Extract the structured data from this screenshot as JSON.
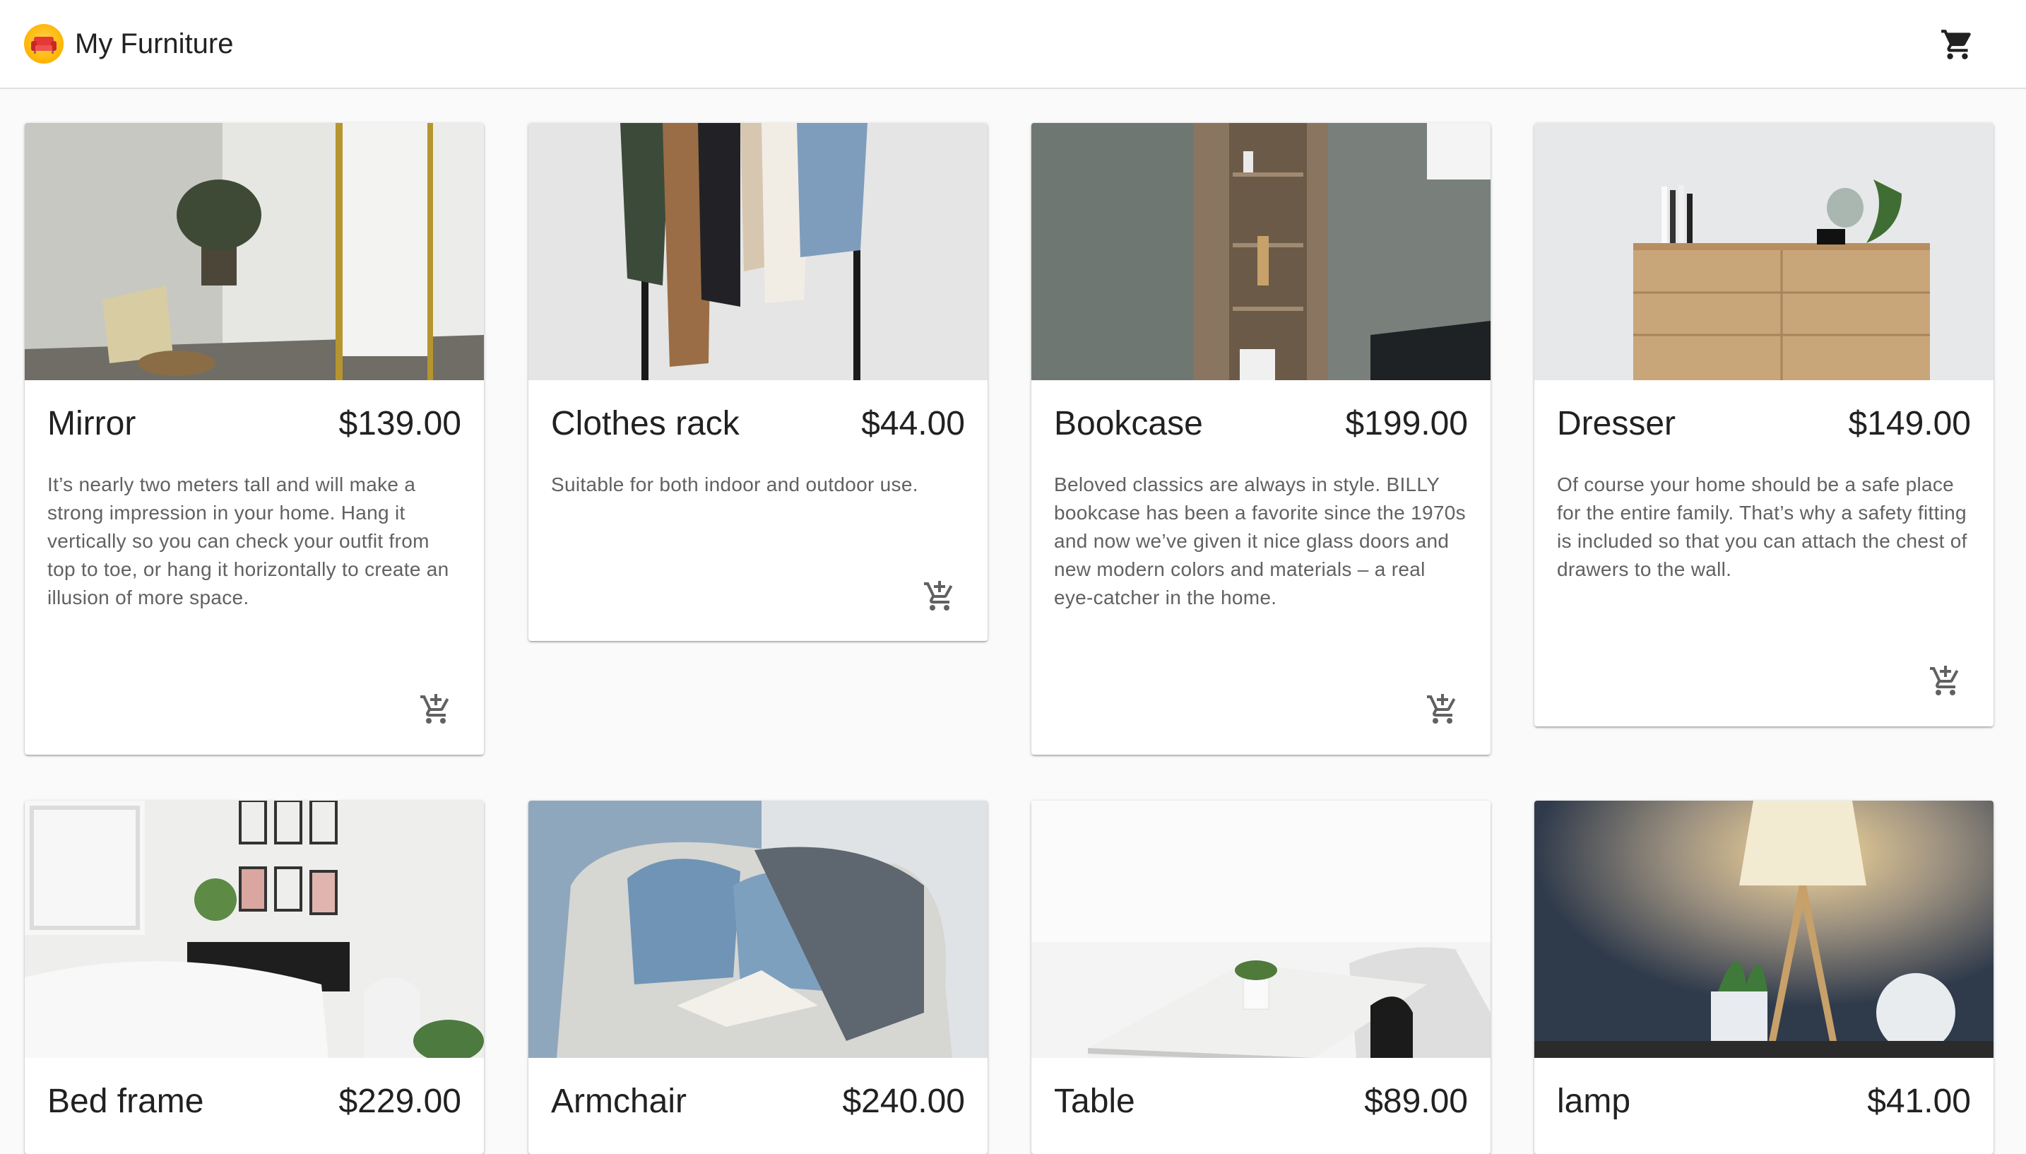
{
  "app": {
    "title": "My Furniture",
    "logo_icon": "sofa-icon",
    "cart_icon": "shopping-cart-icon"
  },
  "colors": {
    "appbar": "#ffffff",
    "background": "#fafafa",
    "logo": "#ffb300",
    "text": "#212121",
    "muted": "#616161"
  },
  "products": [
    {
      "name": "Mirror",
      "price": "$139.00",
      "description": "It’s nearly two meters tall and will make a strong impression in your home. Hang it vertically so you can check your outfit from top to toe, or hang it horizontally to create an illusion of more space.",
      "image": "mirror-photo"
    },
    {
      "name": "Clothes rack",
      "price": "$44.00",
      "description": "Suitable for both indoor and outdoor use.",
      "image": "clothes-rack-photo"
    },
    {
      "name": "Bookcase",
      "price": "$199.00",
      "description": "Beloved classics are always in style. BILLY bookcase has been a favorite since the 1970s and now we’ve given it nice glass doors and new modern colors and materials – a real eye-catcher in the home.",
      "image": "bookcase-photo"
    },
    {
      "name": "Dresser",
      "price": "$149.00",
      "description": "Of course your home should be a safe place for the entire family. That’s why a safety fitting is included so that you can attach the chest of drawers to the wall.",
      "image": "dresser-photo"
    },
    {
      "name": "Bed frame",
      "price": "$229.00",
      "description": "",
      "image": "bed-frame-photo"
    },
    {
      "name": "Armchair",
      "price": "$240.00",
      "description": "",
      "image": "armchair-photo"
    },
    {
      "name": "Table",
      "price": "$89.00",
      "description": "",
      "image": "table-photo"
    },
    {
      "name": "lamp",
      "price": "$41.00",
      "description": "",
      "image": "lamp-photo"
    }
  ],
  "add_to_cart_icon": "add-shopping-cart-icon"
}
